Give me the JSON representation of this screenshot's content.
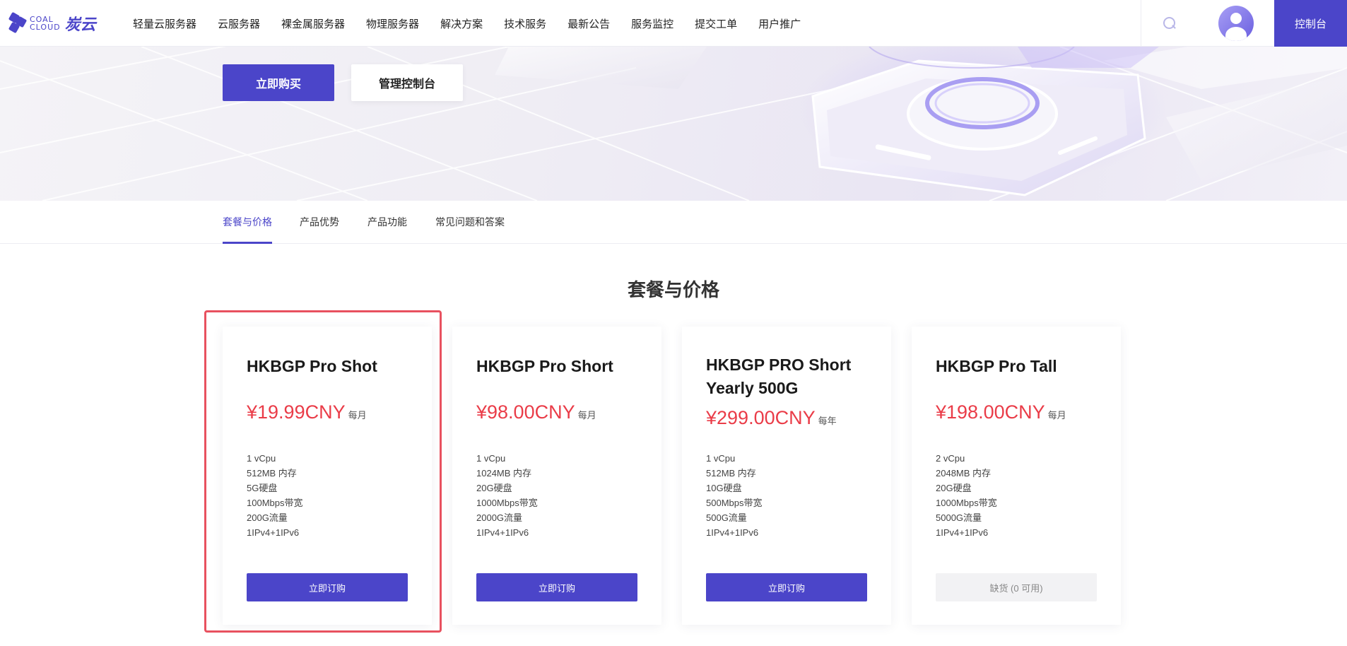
{
  "header": {
    "logo_en_top": "COAL",
    "logo_en_bottom": "CLOUD",
    "logo_cn": "炭云",
    "nav": [
      "轻量云服务器",
      "云服务器",
      "裸金属服务器",
      "物理服务器",
      "解决方案",
      "技术服务",
      "最新公告",
      "服务监控",
      "提交工单",
      "用户推广"
    ],
    "console_label": "控制台",
    "accent_color": "#4b45c9"
  },
  "hero": {
    "buy_label": "立即购买",
    "manage_label": "管理控制台"
  },
  "tabs": [
    "套餐与价格",
    "产品优势",
    "产品功能",
    "常见问题和答案"
  ],
  "section": {
    "title": "套餐与价格"
  },
  "cards": [
    {
      "title": "HKBGP Pro Shot",
      "price": "¥19.99CNY",
      "unit": "每月",
      "specs": [
        "1 vCpu",
        "512MB 内存",
        "5G硬盘",
        "100Mbps带宽",
        "200G流量",
        "1IPv4+1IPv6"
      ],
      "button": "立即订购",
      "available": true
    },
    {
      "title": "HKBGP Pro Short",
      "price": "¥98.00CNY",
      "unit": "每月",
      "specs": [
        "1 vCpu",
        "1024MB 内存",
        "20G硬盘",
        "1000Mbps带宽",
        "2000G流量",
        "1IPv4+1IPv6"
      ],
      "button": "立即订购",
      "available": true
    },
    {
      "title": "HKBGP PRO Short Yearly 500G",
      "price": "¥299.00CNY",
      "unit": "每年",
      "specs": [
        "1 vCpu",
        "512MB 内存",
        "10G硬盘",
        "500Mbps带宽",
        "500G流量",
        "1IPv4+1IPv6"
      ],
      "button": "立即订购",
      "available": true
    },
    {
      "title": "HKBGP Pro Tall",
      "price": "¥198.00CNY",
      "unit": "每月",
      "specs": [
        "2 vCpu",
        "2048MB 内存",
        "20G硬盘",
        "1000Mbps带宽",
        "5000G流量",
        "1IPv4+1IPv6"
      ],
      "button": "缺货 (0 可用)",
      "available": false
    }
  ]
}
